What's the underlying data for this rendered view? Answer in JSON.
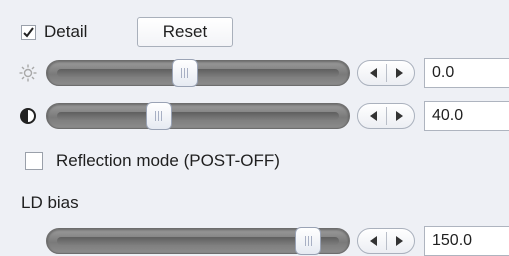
{
  "detail": {
    "label": "Detail",
    "checked": true
  },
  "reset_button": {
    "label": "Reset"
  },
  "sliders": [
    {
      "icon": "sun-icon",
      "value": "0.0",
      "position": 0.45
    },
    {
      "icon": "contrast-icon",
      "value": "40.0",
      "position": 0.35
    },
    {
      "icon": "",
      "value": "150.0",
      "position": 0.92
    }
  ],
  "reflection_mode": {
    "label": "Reflection mode (POST-OFF)",
    "checked": false
  },
  "ld_bias": {
    "label": "LD bias"
  },
  "colors": {
    "background": "#eef0f5",
    "track": "#8a8a8a"
  }
}
